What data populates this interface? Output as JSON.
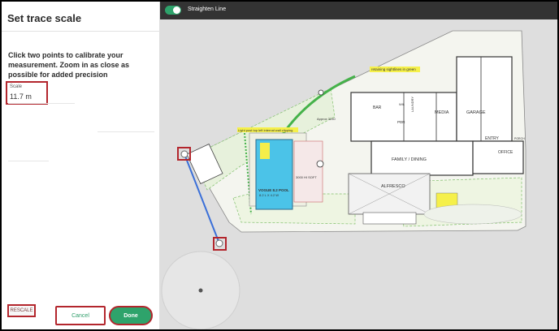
{
  "panel": {
    "title": "Set trace scale",
    "instructions": "Click two points to calibrate your measurement. Zoom in as close as possible for added precision",
    "scale_label": "Scale",
    "scale_value": "11.7 m"
  },
  "buttons": {
    "rescale": "RESCALE",
    "cancel": "Cancel",
    "done": "Done"
  },
  "toolbar": {
    "straighten_label": "Straighten Line",
    "straighten_on": true
  },
  "plan": {
    "rooms": {
      "bar": "BAR",
      "wil": "WIL",
      "laundry": "LAUNDRY",
      "pdr": "PDR",
      "media": "MEDIA",
      "garage": "GARAGE",
      "entry": "ENTRY",
      "office": "OFFICE",
      "family_dining": "FAMILY / DINING",
      "alfresco": "ALFRESCO",
      "pool_line1": "VOGUE 8.2 POOL",
      "pool_line2": "8.2 L X 4.2 W",
      "wall": "3000 HI SOFT",
      "porch": "PORCH"
    },
    "notes": {
      "green_note": "retaining sightlines in green",
      "yellow_note": "Light post top left internal wall clipping",
      "approx": "Approx 3250"
    }
  },
  "colors": {
    "accent_green": "#2ea36b",
    "highlight_red": "#b3262d",
    "measure_line": "#3a6fd8",
    "topbar": "#333333"
  }
}
